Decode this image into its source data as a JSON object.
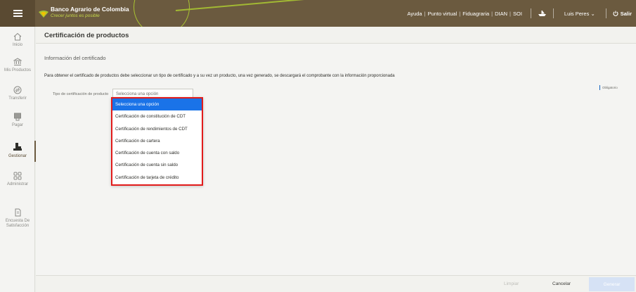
{
  "colors": {
    "topbar": "#6b5a3f",
    "accent": "#a9c332",
    "selected": "#1a73e8",
    "highlight_border": "#e21b1b"
  },
  "header": {
    "brand": "Banco Agrario de Colombia",
    "tagline": "Crecer juntos es posible",
    "nav": [
      "Ayuda",
      "Punto virtual",
      "Fiduagraria",
      "DIAN",
      "SOI"
    ],
    "user": "Luis Peres",
    "logout": "Salir"
  },
  "sidebar": {
    "items": [
      {
        "label": "Inicio",
        "icon": "home-icon"
      },
      {
        "label": "Mis Productos",
        "icon": "bank-icon"
      },
      {
        "label": "Transferir",
        "icon": "transfer-icon"
      },
      {
        "label": "Pagar",
        "icon": "pay-icon"
      },
      {
        "label": "Gestionar",
        "icon": "manage-icon",
        "active": true
      },
      {
        "label": "Administrar",
        "icon": "grid-icon"
      },
      {
        "label": "Encuesta De Satisfacción",
        "icon": "survey-icon"
      }
    ]
  },
  "page": {
    "title": "Certificación de productos",
    "section_title": "Información del certificado",
    "description": "Para obtener el certificado de productos debe seleccionar un tipo de certificado y a su vez un producto, una vez generado, se descargará el comprobante con la información proporcionada",
    "required_note": "Obligatorio",
    "field_label": "Tipo de certificación de producto",
    "select_value": "Selecciona una opción"
  },
  "dropdown": {
    "options": [
      "Selecciona una opción",
      "Certificación de constitución de CDT",
      "Certificación de rendimientos de CDT",
      "Certificación de cartera",
      "Certificación de cuenta con saldo",
      "Certificación de cuenta sin saldo",
      "Certificación de tarjeta de crédito"
    ],
    "selected_index": 0
  },
  "footer": {
    "clear": "Limpiar",
    "cancel": "Cancelar",
    "generate": "Generar"
  }
}
